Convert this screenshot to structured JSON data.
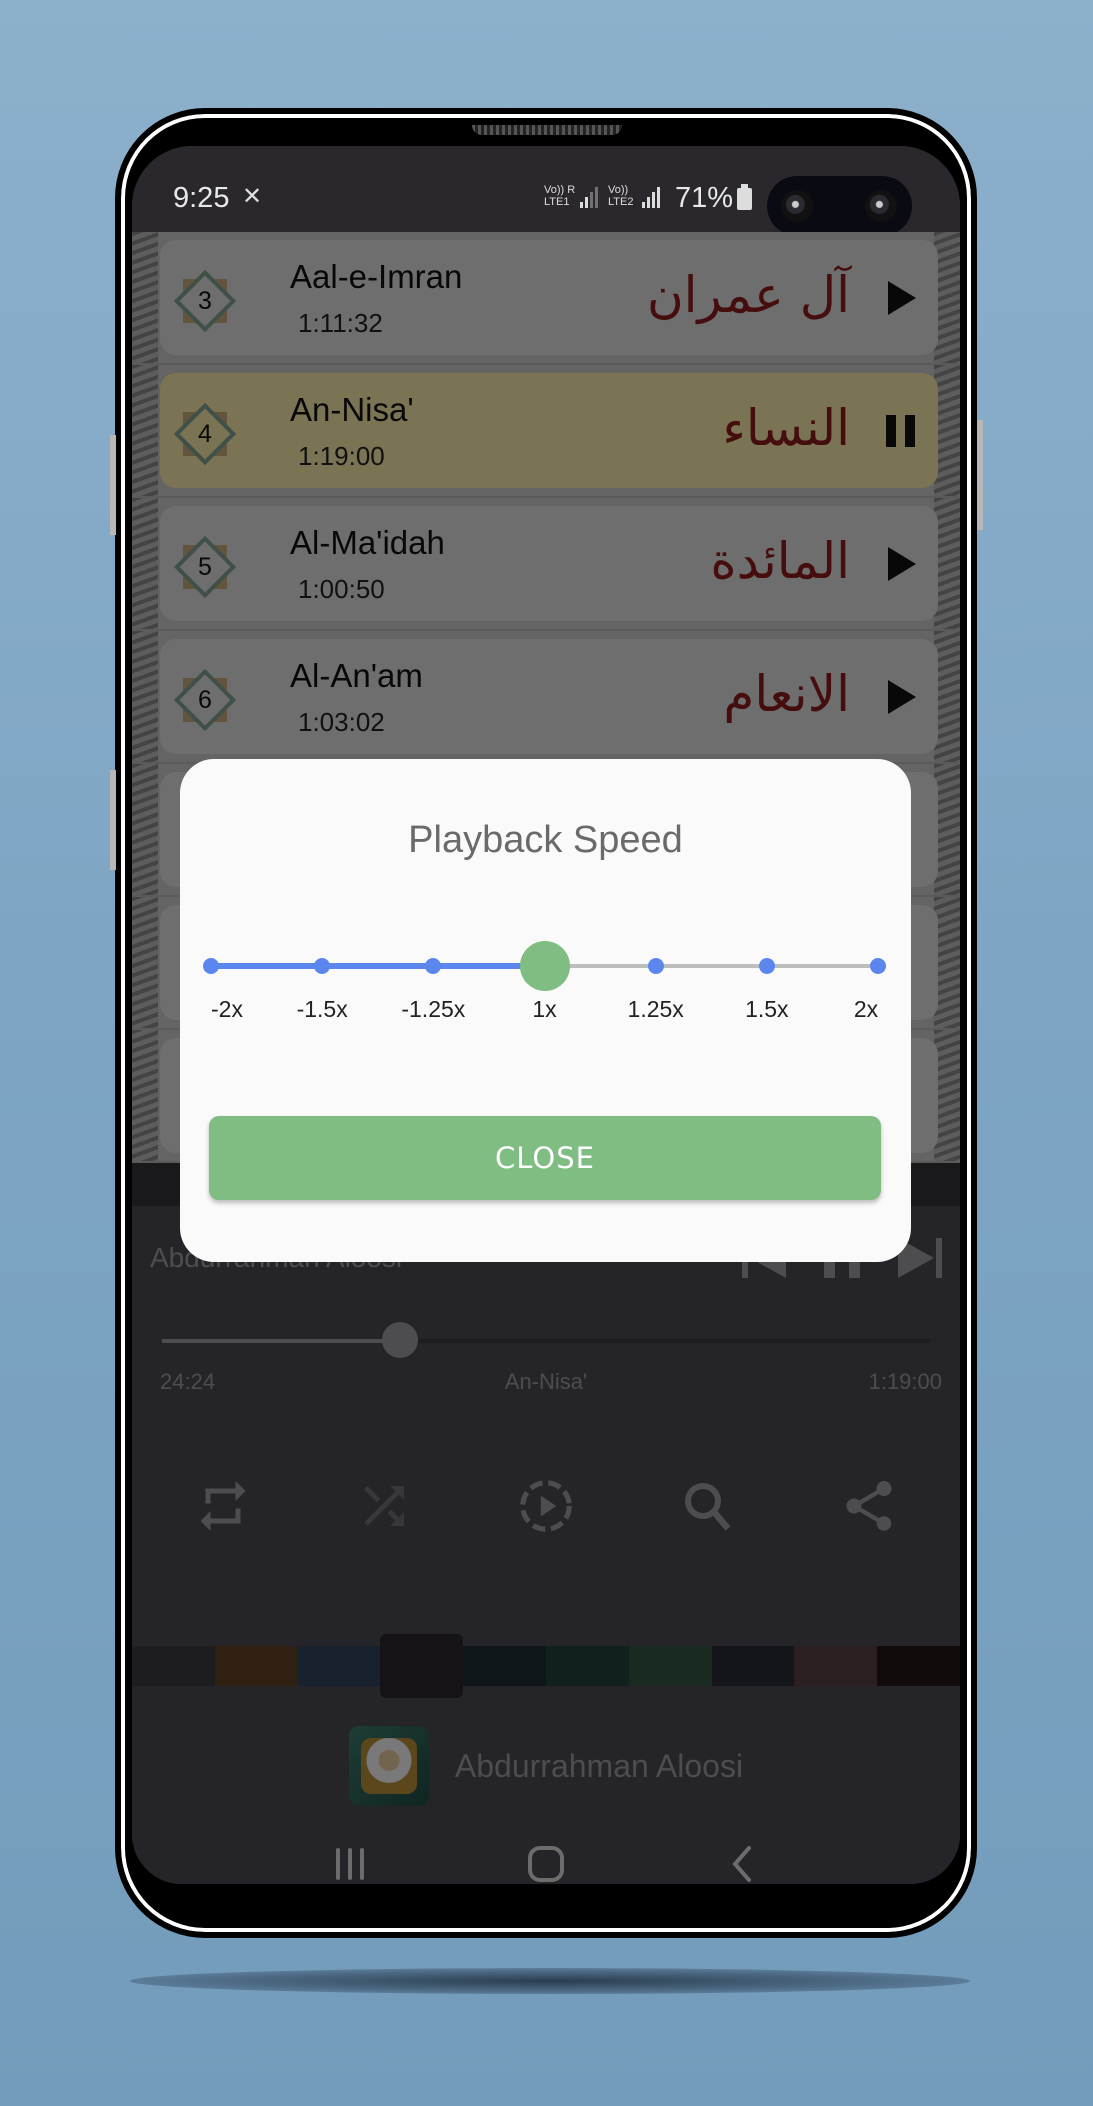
{
  "status_bar": {
    "time": "9:25",
    "app_icon": "quran-reader-icon",
    "sim1_label_top": "Vo)) R",
    "sim1_label_bottom": "LTE1",
    "sim2_label_top": "Vo))",
    "sim2_label_bottom": "LTE2",
    "battery": "71%"
  },
  "surah_list": [
    {
      "number": "3",
      "name": "Aal-e-Imran",
      "duration": "1:11:32",
      "arabic": "آل عمران",
      "state": "play",
      "active": false
    },
    {
      "number": "4",
      "name": "An-Nisa'",
      "duration": "1:19:00",
      "arabic": "النساء",
      "state": "pause",
      "active": true
    },
    {
      "number": "5",
      "name": "Al-Ma'idah",
      "duration": "1:00:50",
      "arabic": "المائدة",
      "state": "play",
      "active": false
    },
    {
      "number": "6",
      "name": "Al-An'am",
      "duration": "1:03:02",
      "arabic": "الانعام",
      "state": "play",
      "active": false
    }
  ],
  "player": {
    "reciter": "Abdurrahman Aloosi",
    "current_time": "24:24",
    "track_title": "An-Nisa'",
    "total_time": "1:19:00",
    "progress_fraction": 0.31,
    "controls": [
      "skip-previous-icon",
      "pause-icon",
      "skip-next-icon"
    ],
    "tools": [
      "repeat-icon",
      "shuffle-icon",
      "playback-speed-icon",
      "search-icon",
      "share-icon"
    ],
    "theme_swatches": [
      "#3a3b3f",
      "#5e4124",
      "#31455c",
      "#2a262c",
      "#1c2c33",
      "#25403a",
      "#335440",
      "#272a36",
      "#573f45",
      "#241617"
    ],
    "selected_swatch": 3
  },
  "dialog": {
    "title": "Playback Speed",
    "speeds": [
      "-2x",
      "-1.5x",
      "-1.25x",
      "1x",
      "1.25x",
      "1.5x",
      "2x"
    ],
    "selected_index": 3,
    "close_label": "CLOSE",
    "accent_color": "#5b86ee",
    "thumb_color": "#7fbd83"
  },
  "navbar": [
    "recent-apps-icon",
    "home-icon",
    "back-icon"
  ]
}
